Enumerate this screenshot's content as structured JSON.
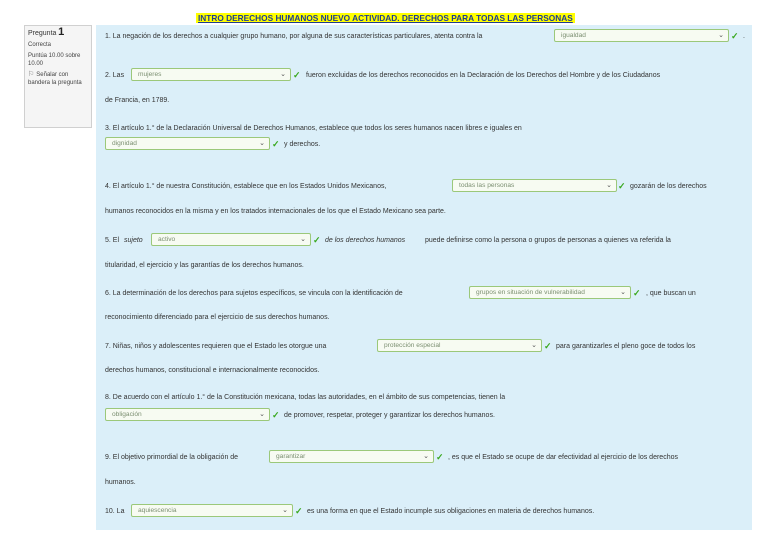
{
  "title": "INTRO DERECHOS HUMANOS NUEVO ACTIVIDAD. DERECHOS PARA TODAS LAS PERSONAS",
  "info": {
    "question_label": "Pregunta",
    "question_number": "1",
    "state": "Correcta",
    "score": "Puntúa 10.00 sobre 10.00",
    "flag_label": "Señalar con bandera la pregunta"
  },
  "icons": {
    "dropdown": "chevron-down-icon",
    "check": "checkmark-icon",
    "flag": "flag-icon"
  },
  "colors": {
    "title_bg": "#ffff00",
    "title_text": "#1f3d8f",
    "panel_bg": "#dbeff9",
    "correct": "#39a81e"
  },
  "questions": {
    "q1": {
      "pre": "1. La negación de los derechos a cualquier grupo humano, por alguna de sus características particulares, atenta contra la",
      "answer": "igualdad",
      "post": "."
    },
    "q2": {
      "pre": "2. Las",
      "answer": "mujeres",
      "post": "fueron excluidas de los derechos reconocidos en la Declaración de los Derechos del Hombre y de los Ciudadanos",
      "line2": "de Francia, en 1789."
    },
    "q3": {
      "pre": "3. El artículo 1.° de la Declaración Universal de Derechos Humanos, establece que todos los seres humanos nacen libres e iguales en",
      "answer": "dignidad",
      "post": "y derechos."
    },
    "q4": {
      "pre": "4. El artículo 1.° de nuestra Constitución, establece que en los Estados Unidos Mexicanos,",
      "answer": "todas las personas",
      "post": "gozarán de los derechos",
      "line2": "humanos reconocidos en la misma y en los tratados internacionales de los que el Estado Mexicano sea parte."
    },
    "q5": {
      "pre": "5. El",
      "pre_italic": "sujeto",
      "answer": "activo",
      "post_italic": "de los derechos humanos",
      "post": "puede definirse como la persona o grupos de personas a quienes va referida la",
      "line2": "titularidad, el ejercicio y las garantías de los derechos humanos."
    },
    "q6": {
      "pre": "6. La determinación de los derechos para sujetos específicos, se vincula con la identificación de",
      "answer": "grupos en situación de vulnerabilidad",
      "post": ", que buscan un",
      "line2": "reconocimiento diferenciado para el ejercicio de sus derechos humanos."
    },
    "q7": {
      "pre": "7. Niñas, niños y adolescentes requieren que el Estado les otorgue una",
      "answer": "protección especial",
      "post": "para garantizarles el pleno goce de todos los",
      "line2": "derechos humanos, constitucional e internacionalmente reconocidos."
    },
    "q8": {
      "pre": "8. De acuerdo con el artículo 1.° de la Constitución mexicana, todas las autoridades, en el ámbito de sus competencias, tienen la",
      "answer": "obligación",
      "post": "de promover, respetar, proteger y garantizar los derechos humanos."
    },
    "q9": {
      "pre": "9. El objetivo primordial de la obligación de",
      "answer": "garantizar",
      "post": ", es que el Estado se ocupe de dar efectividad al ejercicio de los derechos",
      "line2": "humanos."
    },
    "q10": {
      "pre": "10. La",
      "answer": "aquiescencia",
      "post": "es una forma en que el Estado incumple sus obligaciones en materia de derechos humanos."
    }
  }
}
